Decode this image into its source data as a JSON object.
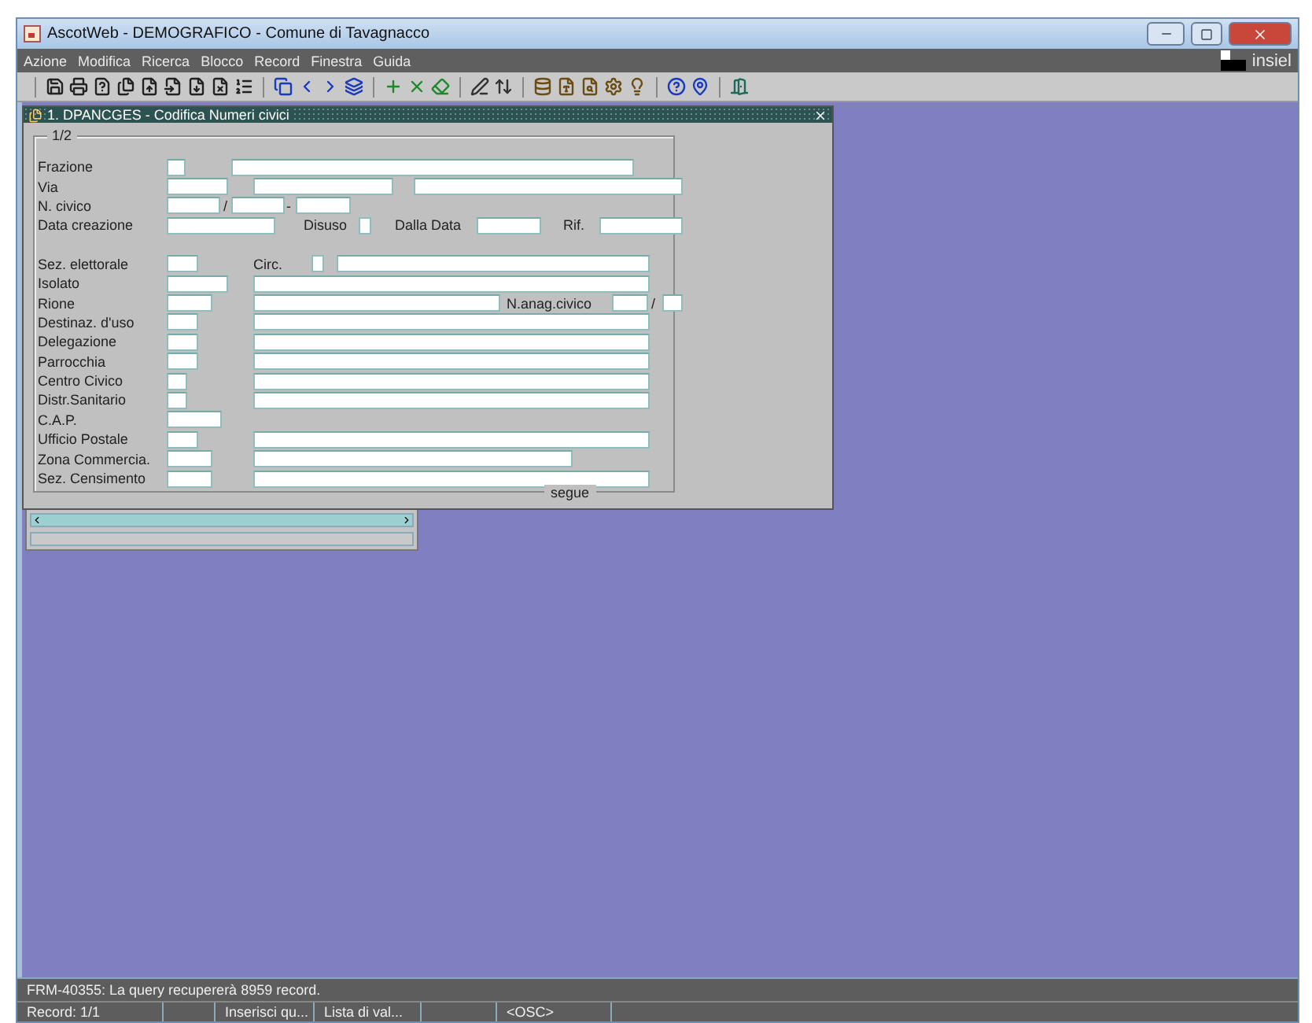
{
  "window": {
    "title": "AscotWeb - DEMOGRAFICO - Comune di Tavagnacco"
  },
  "menu": [
    "Azione",
    "Modifica",
    "Ricerca",
    "Blocco",
    "Record",
    "Finestra",
    "Guida"
  ],
  "brand": "insiel",
  "form": {
    "title": "1. DPANCGES - Codifica Numeri civici",
    "page": "1/2",
    "footer": "segue",
    "groups": [
      [
        {
          "label": "Frazione",
          "items": [
            {
              "kind": "field"
            },
            {
              "kind": "field"
            }
          ]
        },
        {
          "label": "Via",
          "items": [
            {
              "kind": "field"
            },
            {
              "kind": "field"
            },
            {
              "kind": "field"
            }
          ]
        },
        {
          "label": "N. civico",
          "items": [
            {
              "kind": "field"
            },
            {
              "kind": "text",
              "text": "/"
            },
            {
              "kind": "field"
            },
            {
              "kind": "text",
              "text": "-"
            },
            {
              "kind": "field"
            }
          ]
        },
        {
          "label": "Data creazione",
          "items": [
            {
              "kind": "field"
            },
            {
              "kind": "text",
              "text": "Disuso"
            },
            {
              "kind": "checkbox",
              "checked": false
            },
            {
              "kind": "text",
              "text": "Dalla Data"
            },
            {
              "kind": "field"
            },
            {
              "kind": "text",
              "text": "Rif."
            },
            {
              "kind": "field"
            }
          ]
        }
      ],
      [
        {
          "label": "Sez. elettorale",
          "items": [
            {
              "kind": "field"
            },
            {
              "kind": "text",
              "text": "Circ."
            },
            {
              "kind": "checkbox",
              "checked": false
            },
            {
              "kind": "field"
            }
          ]
        },
        {
          "label": "Isolato",
          "items": [
            {
              "kind": "field"
            },
            {
              "kind": "field"
            }
          ]
        },
        {
          "label": "Rione",
          "items": [
            {
              "kind": "field"
            },
            {
              "kind": "field"
            },
            {
              "kind": "text",
              "text": "N.anag.civico"
            },
            {
              "kind": "field"
            },
            {
              "kind": "text",
              "text": "/"
            },
            {
              "kind": "field"
            }
          ]
        },
        {
          "label": "Destinaz. d'uso",
          "items": [
            {
              "kind": "field"
            },
            {
              "kind": "field"
            }
          ]
        },
        {
          "label": "Delegazione",
          "items": [
            {
              "kind": "field"
            },
            {
              "kind": "field"
            }
          ]
        },
        {
          "label": "Parrocchia",
          "items": [
            {
              "kind": "field"
            },
            {
              "kind": "field"
            }
          ]
        },
        {
          "label": "Centro Civico",
          "items": [
            {
              "kind": "field"
            },
            {
              "kind": "field"
            }
          ]
        },
        {
          "label": "Distr.Sanitario",
          "items": [
            {
              "kind": "field"
            },
            {
              "kind": "field"
            }
          ]
        },
        {
          "label": "C.A.P.",
          "items": [
            {
              "kind": "field"
            }
          ]
        },
        {
          "label": "Ufficio Postale",
          "items": [
            {
              "kind": "field"
            },
            {
              "kind": "field"
            }
          ]
        },
        {
          "label": "Zona Commercia.",
          "items": [
            {
              "kind": "field"
            },
            {
              "kind": "field"
            }
          ]
        },
        {
          "label": "Sez. Censimento",
          "items": [
            {
              "kind": "field"
            },
            {
              "kind": "field"
            }
          ]
        }
      ]
    ]
  },
  "status": {
    "message": "FRM-40355: La query recupererà 8959 record.",
    "cells": [
      "Record: 1/1",
      "",
      "Inserisci qu...",
      "Lista di val...",
      "",
      "<OSC>"
    ]
  }
}
